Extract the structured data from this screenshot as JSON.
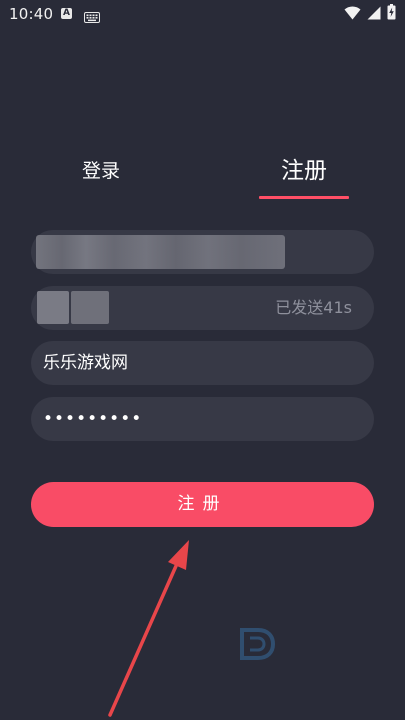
{
  "status_bar": {
    "time": "10:40",
    "notification_letter": "A",
    "icons": [
      "a-notification-icon",
      "keyboard-icon",
      "wifi-icon",
      "signal-icon",
      "battery-charging-icon"
    ]
  },
  "tabs": {
    "login": "登录",
    "register": "注册",
    "active": "register"
  },
  "form": {
    "phone": {
      "value": "",
      "redacted": true
    },
    "verification_code": {
      "value": "",
      "redacted": true,
      "sent_status": "已发送41s"
    },
    "nickname": {
      "value": "乐乐游戏网"
    },
    "password": {
      "value": "•••••••••"
    },
    "submit_label": "注册"
  },
  "colors": {
    "background": "#292b38",
    "field_background": "#373946",
    "accent": "#f94c66",
    "muted_text": "#8e909c"
  }
}
